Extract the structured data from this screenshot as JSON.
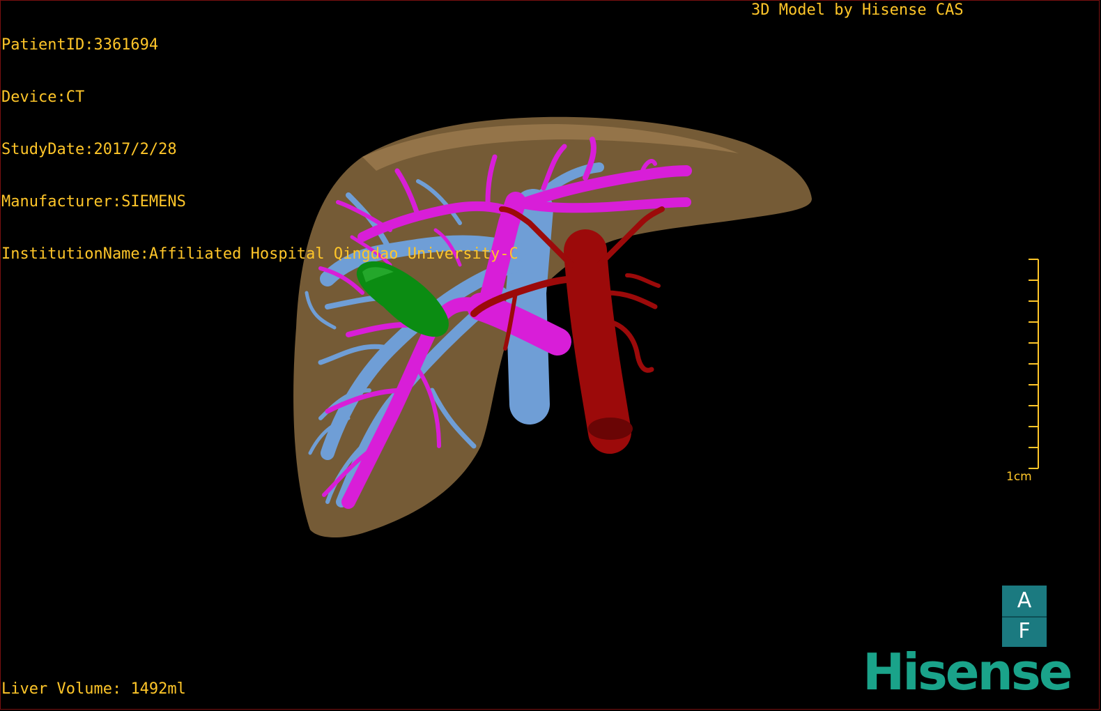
{
  "patient": {
    "patient_id": "PatientID:3361694",
    "device": "Device:CT",
    "study_date": "StudyDate:2017/2/28",
    "manufacturer": "Manufacturer:SIEMENS",
    "institution": "InstitutionName:Affiliated Hospital Qingdao University-C"
  },
  "credit": "3D Model by Hisense CAS",
  "liver_volume": {
    "label": "Liver Volume:",
    "value": "1492ml"
  },
  "scale_bar": {
    "label": "1cm",
    "ticks": 10
  },
  "orientation": {
    "top": "A",
    "bottom": "F"
  },
  "logo": "Hisense",
  "colors": {
    "text": "#ffc629",
    "liver": "#8a6b40",
    "portal_vein": "#d81ed8",
    "hepatic_vein": "#6f9ed6",
    "artery": "#9c0a0a",
    "tumor": "#0b8c12",
    "orientation_box": "#1b7a80",
    "logo": "#1aa38a"
  }
}
